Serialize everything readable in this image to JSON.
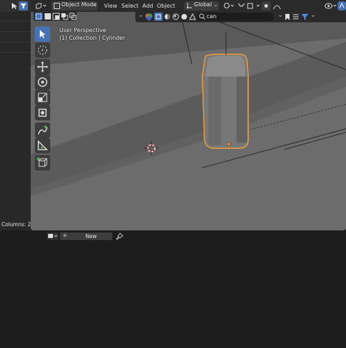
{
  "header": {
    "mode_label": "Object Mode",
    "menu": [
      "View",
      "Select",
      "Add",
      "Object"
    ],
    "transform_orientation": "Global"
  },
  "search": {
    "value": "can"
  },
  "overlay": {
    "view_name": "User Perspective",
    "collection_line": "(1) Collection | Cylinder"
  },
  "outliner": {
    "columns_label": "Columns: 2"
  },
  "datablock": {
    "new_label": "New",
    "add_symbol": "+"
  },
  "colors": {
    "selection_outline": "#f5a033",
    "active_tool": "#4772b3",
    "viewport_floor": "#6a6a6a"
  },
  "icons": [
    "menu-icon",
    "filter-icon",
    "object-mode-icon",
    "global-icon",
    "snap-icon",
    "proportional-icon",
    "search-icon",
    "bookmark-icon",
    "cursor-tool-icon",
    "move-icon",
    "rotate-icon",
    "scale-icon",
    "transform-icon",
    "annotate-icon",
    "measure-icon",
    "add-cube-icon",
    "pin-icon",
    "3d-cursor-icon"
  ]
}
